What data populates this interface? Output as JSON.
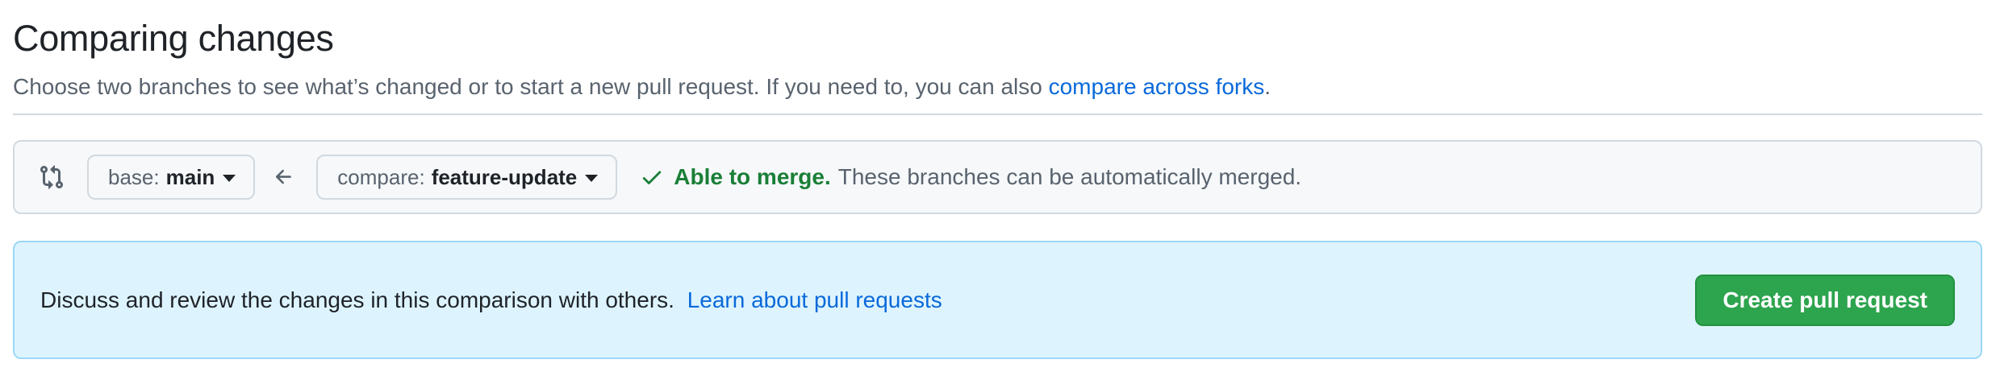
{
  "header": {
    "title": "Comparing changes",
    "subtitle_text": "Choose two branches to see what’s changed or to start a new pull request. If you need to, you can also",
    "subtitle_link": "compare across forks",
    "subtitle_end": "."
  },
  "range": {
    "base_prefix": "base:",
    "base_branch": "main",
    "compare_prefix": "compare:",
    "compare_branch": "feature-update",
    "merge_status": "Able to merge.",
    "merge_description": "These branches can be automatically merged."
  },
  "flash": {
    "text": "Discuss and review the changes in this comparison with others.",
    "link": "Learn about pull requests",
    "button_label": "Create pull request"
  },
  "icons": {
    "compare": "git-compare-icon",
    "arrow": "arrow-left-icon",
    "check": "check-icon",
    "caret": "triangle-down-icon"
  },
  "colors": {
    "link": "#0969da",
    "success": "#1a7f37",
    "button": "#2da44e",
    "flash_bg": "#ddf4ff",
    "flash_border": "#9cd7f7"
  }
}
